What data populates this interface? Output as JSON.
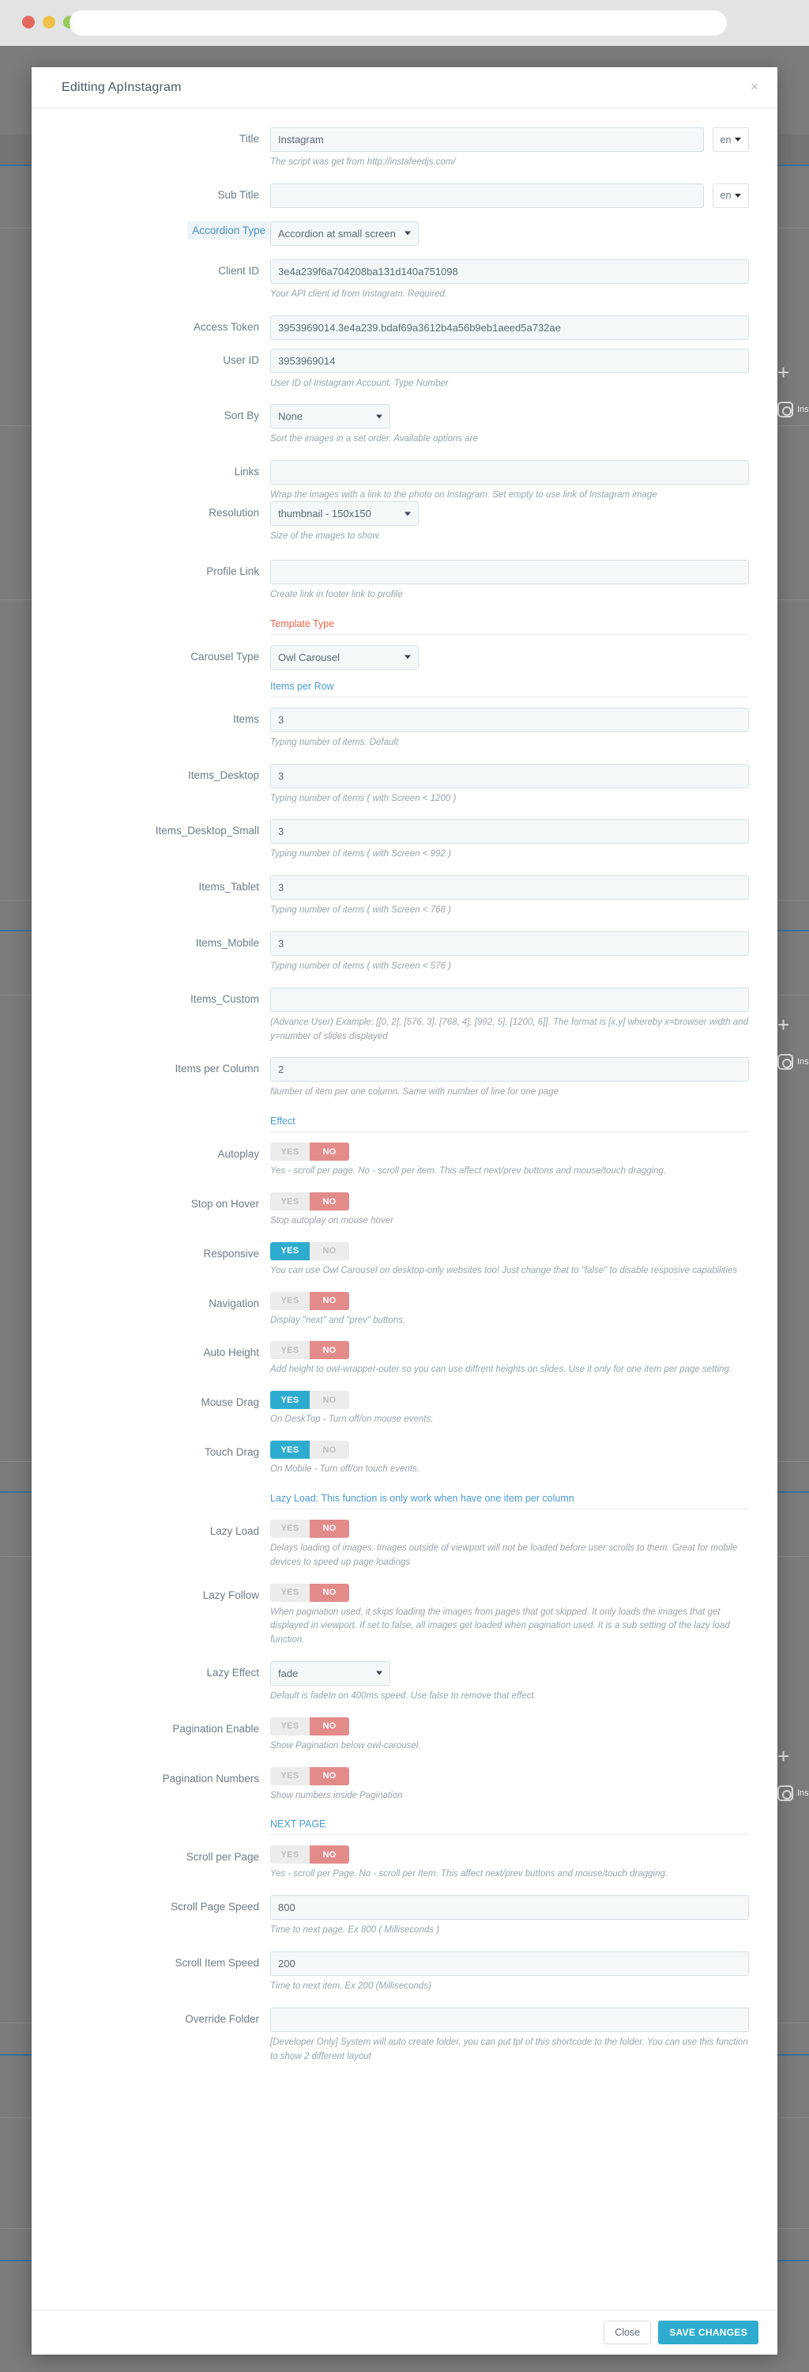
{
  "browser": {
    "traffic_lights": [
      "red",
      "yellow",
      "green"
    ],
    "url_value": "",
    "url_placeholder": ""
  },
  "backdrop": {
    "widgets": [
      {
        "plus": "+",
        "label": "Instagram"
      },
      {
        "plus": "+",
        "label": "Instagram"
      },
      {
        "plus": "+",
        "label": "Instagram"
      }
    ]
  },
  "modal": {
    "title": "Editting ApInstagram",
    "close_icon": "×",
    "footer": {
      "close_label": "Close",
      "save_label": "SAVE CHANGES"
    }
  },
  "colors": {
    "accent_blue": "#2eaccf",
    "link_blue": "#4c9ad4",
    "danger_red": "#f06449",
    "toggle_no": "#e38b8b",
    "toggle_off": "#ececec"
  },
  "form": {
    "title": {
      "label": "Title",
      "value": "Instagram",
      "placeholder": "",
      "lang": "en",
      "help": "The script was get from http://instafeedjs.com/"
    },
    "sub_title": {
      "label": "Sub Title",
      "value": "",
      "placeholder": "",
      "lang": "en",
      "help": ""
    },
    "accordion_type": {
      "label": "Accordion Type",
      "value": "Accordion at small screen",
      "help": ""
    },
    "client_id": {
      "label": "Client ID",
      "value": "3e4a239f6a704208ba131d140a751098",
      "help": "Your API client id from Instagram. Required."
    },
    "access_token": {
      "label": "Access Token",
      "value": "3953969014.3e4a239.bdaf69a3612b4a56b9eb1aeed5a732ae",
      "help": ""
    },
    "user_id": {
      "label": "User ID",
      "value": "3953969014",
      "help": "User ID of Instagram Account. Type Number"
    },
    "sort_by": {
      "label": "Sort By",
      "value": "None",
      "help": "Sort the images in a set order. Available options are"
    },
    "links": {
      "label": "Links",
      "value": "",
      "help": "Wrap the images with a link to the photo on Instagram. Set empty to use link of Instagram image"
    },
    "resolution": {
      "label": "Resolution",
      "value": "thumbnail - 150x150",
      "help": "Size of the images to show."
    },
    "profile_link": {
      "label": "Profile Link",
      "value": "",
      "help": "Create link in footer link to profile"
    },
    "template_type_section": "Template Type",
    "carousel_type": {
      "label": "Carousel Type",
      "value": "Owl Carousel",
      "help": ""
    },
    "items_per_row_section": "Items per Row",
    "items": {
      "label": "Items",
      "value": "3",
      "help": "Typing number of items. Default"
    },
    "items_desktop": {
      "label": "Items_Desktop",
      "value": "3",
      "help": "Typing number of items ( with Screen < 1200 )"
    },
    "items_desktop_small": {
      "label": "Items_Desktop_Small",
      "value": "3",
      "help": "Typing number of items ( with Screen < 992 )"
    },
    "items_tablet": {
      "label": "Items_Tablet",
      "value": "3",
      "help": "Typing number of items ( with Screen < 768 )"
    },
    "items_mobile": {
      "label": "Items_Mobile",
      "value": "3",
      "help": "Typing number of items ( with Screen < 576 )"
    },
    "items_custom": {
      "label": "Items_Custom",
      "value": "",
      "help": "(Advance User) Example: [[0, 2], [576, 3], [768, 4], [992, 5], [1200, 6]]. The format is [x,y] whereby x=browser width and y=number of slides displayed"
    },
    "items_per_column": {
      "label": "Items per Column",
      "value": "2",
      "help": "Number of item per one column. Same with number of line for one page"
    },
    "effect_section": "Effect",
    "autoplay": {
      "label": "Autoplay",
      "yes": "YES",
      "no": "NO",
      "state": "no",
      "help": "Yes - scroll per page. No - scroll per item. This affect next/prev buttons and mouse/touch dragging."
    },
    "stop_on_hover": {
      "label": "Stop on Hover",
      "yes": "YES",
      "no": "NO",
      "state": "no",
      "help": "Stop autoplay on mouse hover"
    },
    "responsive": {
      "label": "Responsive",
      "yes": "YES",
      "no": "NO",
      "state": "yes",
      "help": "You can use Owl Carousel on desktop-only websites too! Just change that to \"false\" to disable resposive capabilities"
    },
    "navigation": {
      "label": "Navigation",
      "yes": "YES",
      "no": "NO",
      "state": "no",
      "help": "Display \"next\" and \"prev\" buttons."
    },
    "auto_height": {
      "label": "Auto Height",
      "yes": "YES",
      "no": "NO",
      "state": "no",
      "help": "Add height to owl-wrapper-outer so you can use diffrent heights on slides. Use it only for one item per page setting."
    },
    "mouse_drag": {
      "label": "Mouse Drag",
      "yes": "YES",
      "no": "NO",
      "state": "yes",
      "help": "On DeskTop - Turn off/on mouse events."
    },
    "touch_drag": {
      "label": "Touch Drag",
      "yes": "YES",
      "no": "NO",
      "state": "yes",
      "help": "On Mobile - Turn off/on touch events."
    },
    "lazy_load_section": "Lazy Load: This function is only work when have one item per column",
    "lazy_load": {
      "label": "Lazy Load",
      "yes": "YES",
      "no": "NO",
      "state": "no",
      "help": "Delays loading of images. Images outside of viewport will not be loaded before user scrolls to them. Great for mobile devices to speed up page loadings"
    },
    "lazy_follow": {
      "label": "Lazy Follow",
      "yes": "YES",
      "no": "NO",
      "state": "no",
      "help": "When pagination used, it skips loading the images from pages that got skipped. It only loads the images that get displayed in viewport. If set to false, all images get loaded when pagination used. It is a sub setting of the lazy load function."
    },
    "lazy_effect": {
      "label": "Lazy Effect",
      "value": "fade",
      "help": "Default is fadeIn on 400ms speed. Use false to remove that effect."
    },
    "pagination_enable": {
      "label": "Pagination Enable",
      "yes": "YES",
      "no": "NO",
      "state": "no",
      "help": "Show Pagination below owl-carousel."
    },
    "pagination_numbers": {
      "label": "Pagination Numbers",
      "yes": "YES",
      "no": "NO",
      "state": "no",
      "help": "Show numbers inside Pagination"
    },
    "next_page_section": "NEXT PAGE",
    "scroll_per_page": {
      "label": "Scroll per Page",
      "yes": "YES",
      "no": "NO",
      "state": "no",
      "help": "Yes - scroll per Page. No - scroll per Item. This affect next/prev buttons and mouse/touch dragging."
    },
    "scroll_page_speed": {
      "label": "Scroll Page Speed",
      "value": "800",
      "help": "Time to next page. Ex 800 ( Milliseconds )"
    },
    "scroll_item_speed": {
      "label": "Scroll Item Speed",
      "value": "200",
      "help": "Time to next item. Ex 200 (Milliseconds)"
    },
    "override_folder": {
      "label": "Override Folder",
      "value": "",
      "help": "[Developer Only] System will auto create folder, you can put tpl of this shortcode to the folder. You can use this function to show 2 different layout"
    }
  }
}
